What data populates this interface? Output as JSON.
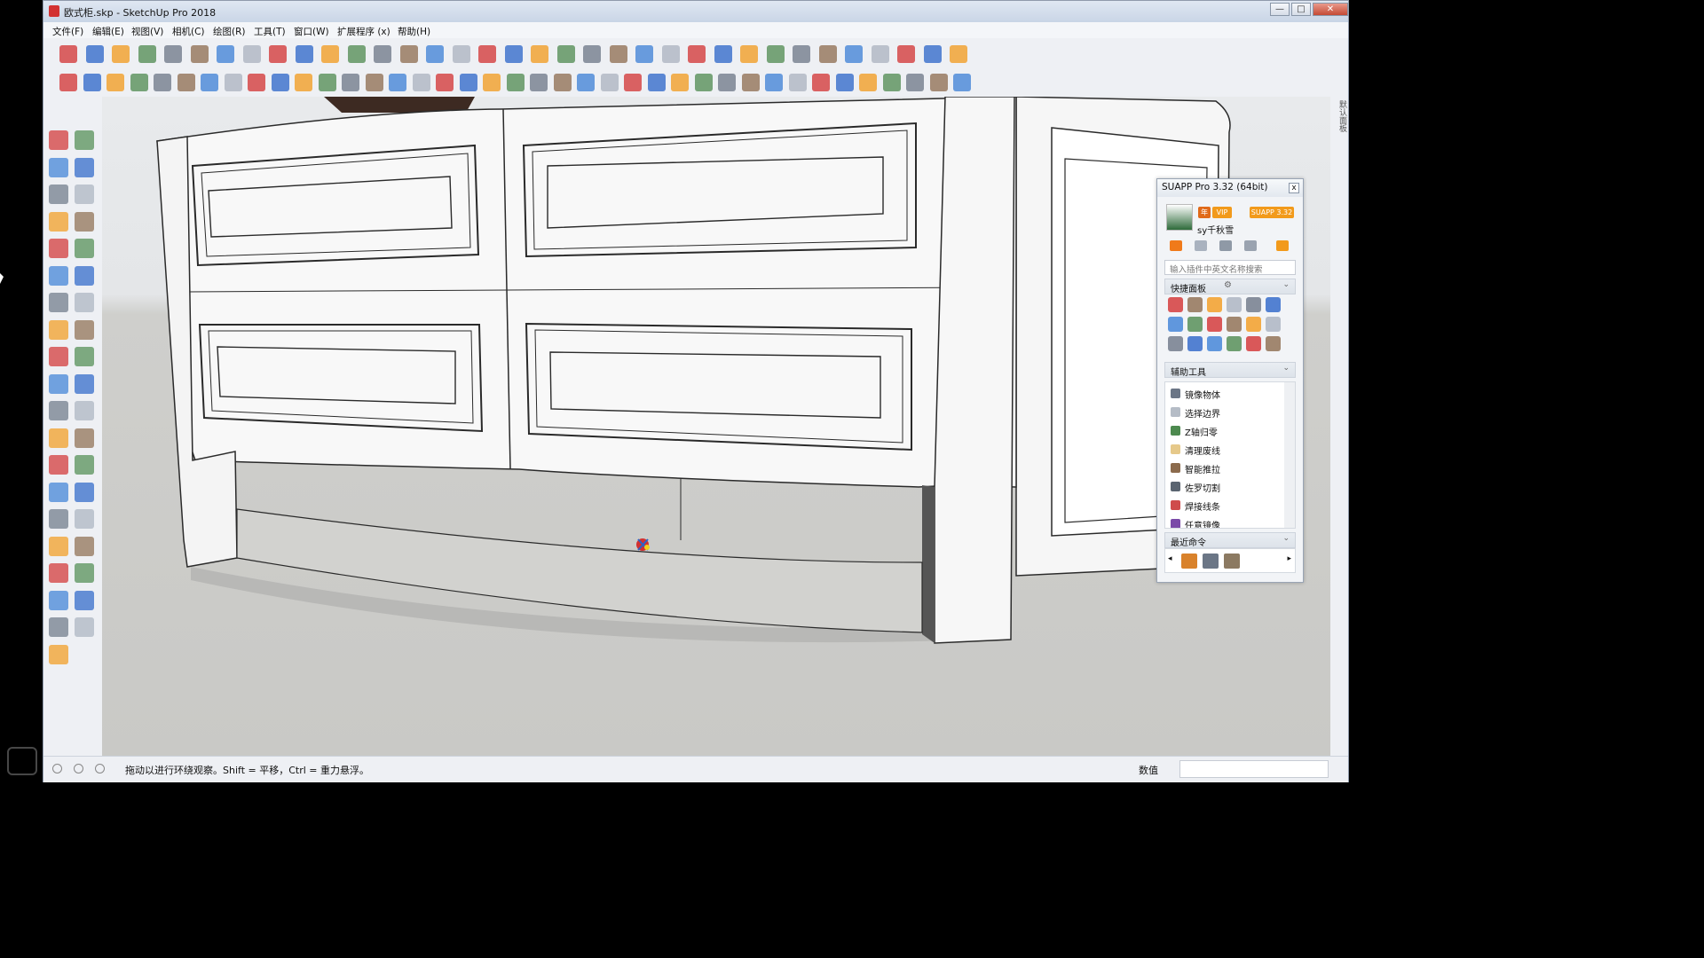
{
  "window": {
    "title": "欧式柜.skp - SketchUp Pro 2018",
    "controls": {
      "minimize": "—",
      "maximize": "□",
      "close": "✕"
    }
  },
  "menu": [
    "文件(F)",
    "编辑(E)",
    "视图(V)",
    "相机(C)",
    "绘图(R)",
    "工具(T)",
    "窗口(W)",
    "扩展程序 (x)",
    "帮助(H)"
  ],
  "right_strip": {
    "label": "默认面板"
  },
  "suapp": {
    "title": "SUAPP Pro 3.32 (64bit)",
    "close": "x",
    "badges": {
      "year": "年",
      "vip": "VIP",
      "version": "SUAPP 3.32"
    },
    "user": "sy千秋雪",
    "search_placeholder": "输入插件中英文名称搜索",
    "quick_panel": "快捷面板",
    "aux_tools": "辅助工具",
    "aux_items": [
      "镜像物体",
      "选择边界",
      "Z轴归零",
      "清理废线",
      "智能推拉",
      "佐罗切割",
      "焊接线条",
      "任意镜像"
    ],
    "recent": "最近命令"
  },
  "status": {
    "text": "拖动以进行环绕观察。Shift = 平移，Ctrl = 重力悬浮。",
    "measure_label": "数值",
    "measure_value": ""
  },
  "colors": {
    "viewport_sky": "#e6e8ea",
    "viewport_ground": "#cbcbc8",
    "model_face": "#ffffff",
    "model_edge": "#2a2a2a",
    "accent_orange": "#f29a1b",
    "accent_red": "#d23131",
    "accent_blue": "#2a64c8"
  },
  "icons": {
    "toolbar_row1": [
      "new-icon",
      "open-icon",
      "save-icon",
      "cut-icon",
      "copy-icon",
      "paste-icon",
      "erase-icon",
      "undo-icon",
      "redo-icon",
      "print-icon",
      "model-info-icon",
      "iso-view-icon",
      "top-view-icon",
      "front-view-icon",
      "right-view-icon",
      "back-view-icon",
      "left-view-icon",
      "xray-icon",
      "back-edges-icon",
      "wireframe-icon",
      "hidden-line-icon",
      "shaded-icon",
      "shaded-textures-icon",
      "monochrome-icon",
      "warehouse-icon",
      "extension-warehouse-icon",
      "layout-icon",
      "section-plane-icon",
      "section-display-icon",
      "section-cut-icon",
      "components-icon",
      "styles-icon",
      "layers-icon",
      "outliner-icon",
      "scenes-icon"
    ],
    "toolbar_row2": [
      "suapp-icon",
      "refresh-icon",
      "camera-icon",
      "sandbox-icon",
      "photo-icon",
      "render-icon",
      "solid-icon",
      "settings-icon",
      "sound-icon",
      "options-icon",
      "comment-icon",
      "info-icon",
      "layout-a-icon",
      "layout-b-icon",
      "table-a-icon",
      "table-b-icon",
      "table-c-icon",
      "table-d-icon",
      "table-e-icon",
      "table-f-icon",
      "table-g-icon",
      "curve-a-icon",
      "curve-b-icon",
      "curve-c-icon",
      "curve-d-icon",
      "curve-e-icon",
      "arc-a-icon",
      "rect-icon",
      "spiral-icon",
      "arc-b-icon",
      "zigzag-icon",
      "hook-a-icon",
      "hook-b-icon",
      "arc-c-icon",
      "line-icon",
      "polygon-icon",
      "wrench-icon",
      "circle-icon",
      "cone-icon"
    ],
    "left_tools": [
      "select-icon",
      "make-component-icon",
      "paint-bucket-icon",
      "eraser-icon",
      "line-icon",
      "freehand-icon",
      "rectangle-icon",
      "rotated-rect-icon",
      "circle-icon",
      "polygon-icon",
      "arc-icon",
      "pie-icon",
      "two-point-arc-icon",
      "three-point-arc-icon",
      "move-icon",
      "push-pull-icon",
      "rotate-icon",
      "follow-me-icon",
      "scale-icon",
      "offset-icon",
      "tape-measure-icon",
      "dimension-icon",
      "protractor-icon",
      "text-icon",
      "axes-icon",
      "3d-text-icon",
      "orbit-icon",
      "pan-icon",
      "zoom-icon",
      "zoom-window-icon",
      "zoom-extents-icon",
      "previous-view-icon",
      "position-camera-icon",
      "look-around-icon",
      "walk-icon",
      "section-plane-icon",
      "sandbox-a-icon",
      "sandbox-b-icon",
      "sandbox-c-icon"
    ]
  }
}
